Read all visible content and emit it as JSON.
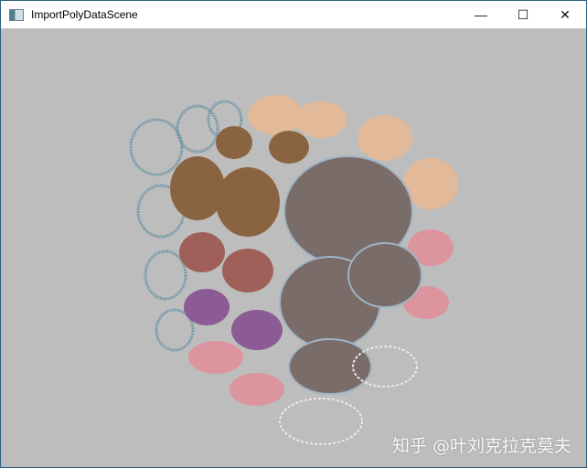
{
  "window": {
    "title": "ImportPolyDataScene",
    "minimize_icon": "minimize-icon",
    "maximize_icon": "maximize-icon",
    "close_icon": "close-icon"
  },
  "watermark": "知乎 @叶刘克拉克莫夫",
  "colors": {
    "background": "#bdbdbd",
    "wire_blue": "#5f8ea3",
    "bronze": "#8a6440",
    "peach": "#e9b993",
    "rose": "#a0605a",
    "purple": "#8c5a94",
    "pink": "#e48a96"
  }
}
